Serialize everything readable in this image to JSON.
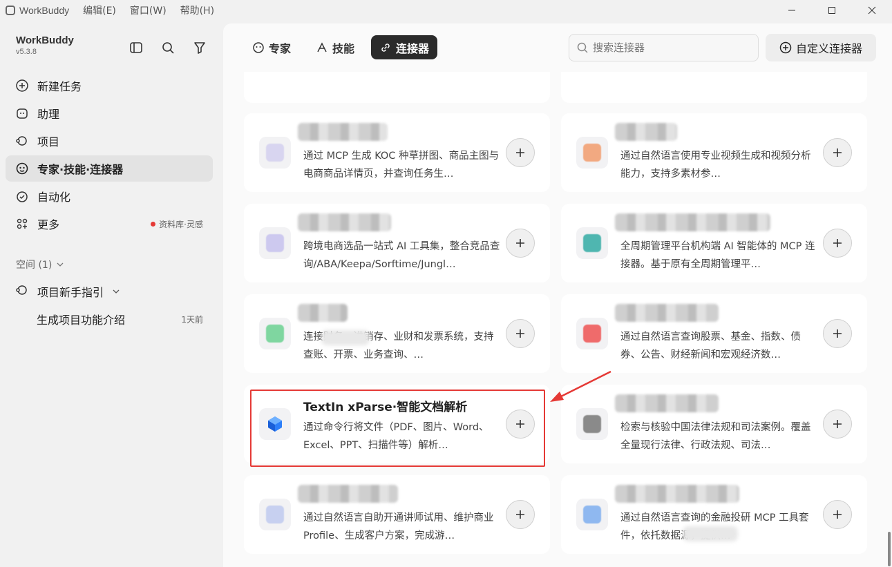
{
  "titlebar": {
    "app_name": "WorkBuddy",
    "menus": [
      "编辑(E)",
      "窗口(W)",
      "帮助(H)"
    ]
  },
  "sidebar": {
    "brand": "WorkBuddy",
    "version": "v5.3.8",
    "nav": [
      {
        "label": "新建任务",
        "icon": "plus-chat-icon"
      },
      {
        "label": "助理",
        "icon": "assistant-icon"
      },
      {
        "label": "项目",
        "icon": "project-icon"
      },
      {
        "label": "专家·技能·连接器",
        "icon": "expert-icon",
        "active": true
      },
      {
        "label": "自动化",
        "icon": "alarm-icon"
      },
      {
        "label": "更多",
        "icon": "grid-icon",
        "badge": "资料库·灵感"
      }
    ],
    "space_label": "空间 (1)",
    "project_name": "项目新手指引",
    "task_name": "生成项目功能介绍",
    "task_time": "1天前"
  },
  "header": {
    "tabs": [
      {
        "label": "专家",
        "icon": "expert-icon"
      },
      {
        "label": "技能",
        "icon": "skill-icon"
      },
      {
        "label": "连接器",
        "icon": "link-icon",
        "active": true
      }
    ],
    "search_placeholder": "搜索连接器",
    "custom_button": "自定义连接器"
  },
  "cards": [
    {
      "title": "",
      "desc": "通过 MCP 生成 KOC 种草拼图、商品主图与电商商品详情页，并查询任务生…",
      "color": "#d8d5f0"
    },
    {
      "title": "",
      "desc": "通过自然语言使用专业视频生成和视频分析能力，支持多素材参…",
      "color": "#f2a981"
    },
    {
      "title": "",
      "desc": "跨境电商选品一站式 AI 工具集，整合竞品查询/ABA/Keepa/Sorftime/Jungl…",
      "color": "#cdc9ef"
    },
    {
      "title": "",
      "desc": "全周期管理平台机构端 AI 智能体的 MCP 连接器。基于原有全周期管理平…",
      "color": "#4fb6b0"
    },
    {
      "title": "",
      "desc": "连接财务、进销存、业财和发票系统，支持查账、开票、业务查询、…",
      "color": "#7fd6a0"
    },
    {
      "title": "",
      "desc": "通过自然语言查询股票、基金、指数、债券、公告、财经新闻和宏观经济数…",
      "color": "#ef6b6b"
    },
    {
      "title": "TextIn xParse·智能文档解析",
      "desc": "通过命令行将文件（PDF、图片、Word、Excel、PPT、扫描件等）解析…",
      "color": "#2d7ff9"
    },
    {
      "title": "",
      "desc": "检索与核验中国法律法规和司法案例。覆盖全量现行法律、行政法规、司法…",
      "color": "#8a8a8a"
    },
    {
      "title": "",
      "desc": "通过自然语言自助开通讲师试用、维护商业 Profile、生成客户方案，完成游…",
      "color": "#c7d0f0"
    },
    {
      "title": "",
      "desc": "通过自然语言查询的金融投研 MCP 工具套件，依托数据源，提供…",
      "color": "#8fb8f0"
    }
  ],
  "colors": {
    "highlight": "#e53935",
    "active_tab": "#2b2b2b"
  }
}
